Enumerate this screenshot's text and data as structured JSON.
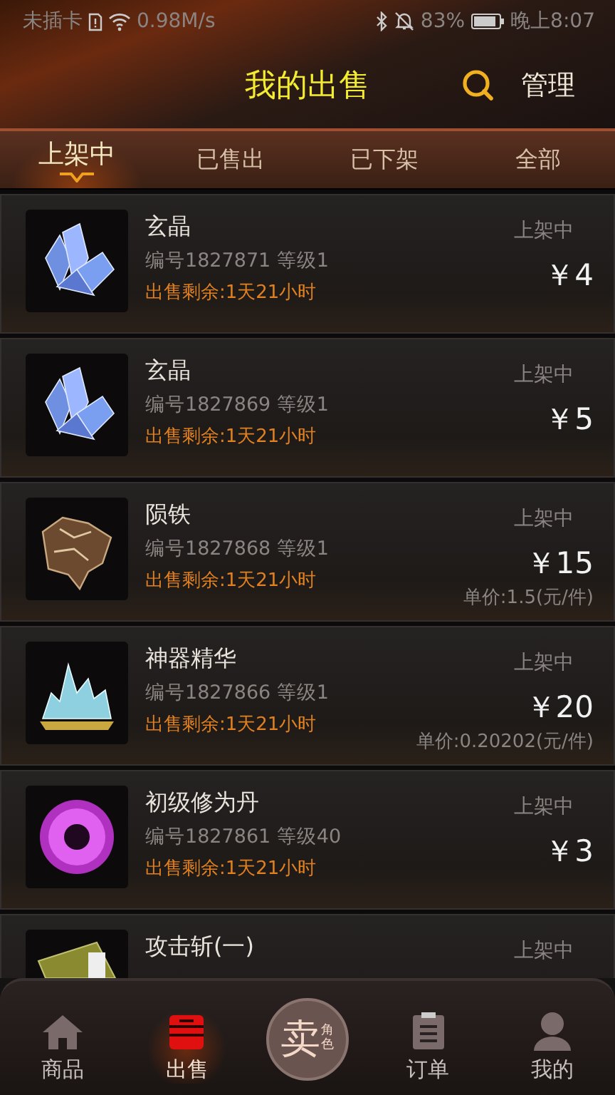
{
  "status_bar": {
    "carrier": "未插卡",
    "speed": "0.98M/s",
    "battery": "83%",
    "time": "晚上8:07"
  },
  "header": {
    "title": "我的出售",
    "manage": "管理"
  },
  "tabs": [
    {
      "label": "上架中",
      "selected": true
    },
    {
      "label": "已售出",
      "selected": false
    },
    {
      "label": "已下架",
      "selected": false
    },
    {
      "label": "全部",
      "selected": false
    }
  ],
  "items": [
    {
      "kind": "crystal",
      "name": "玄晶",
      "details": "编号1827871 等级1",
      "remaining": "出售剩余:1天21小时",
      "status": "上架中",
      "price": "￥4"
    },
    {
      "kind": "crystal",
      "name": "玄晶",
      "details": "编号1827869 等级1",
      "remaining": "出售剩余:1天21小时",
      "status": "上架中",
      "price": "￥5"
    },
    {
      "kind": "ore",
      "name": "陨铁",
      "details": "编号1827868 等级1",
      "remaining": "出售剩余:1天21小时",
      "status": "上架中",
      "price": "￥15",
      "unit_price": "单价:1.5(元/件)"
    },
    {
      "kind": "essence",
      "name": "神器精华",
      "details": "编号1827866 等级1",
      "remaining": "出售剩余:1天21小时",
      "status": "上架中",
      "price": "￥20",
      "unit_price": "单价:0.20202(元/件)"
    },
    {
      "kind": "orb",
      "name": "初级修为丹",
      "details": "编号1827861 等级40",
      "remaining": "出售剩余:1天21小时",
      "status": "上架中",
      "price": "￥3"
    },
    {
      "kind": "book",
      "name": "攻击斩(一)",
      "status": "上架中"
    }
  ],
  "nav": [
    {
      "kind": "home",
      "label": "商品",
      "selected": false
    },
    {
      "kind": "stall",
      "label": "出售",
      "selected": true
    },
    {
      "kind": "sell",
      "label": "卖",
      "sub": "角色",
      "selected": false
    },
    {
      "kind": "clipboard",
      "label": "订单",
      "selected": false
    },
    {
      "kind": "person",
      "label": "我的",
      "selected": false
    }
  ]
}
